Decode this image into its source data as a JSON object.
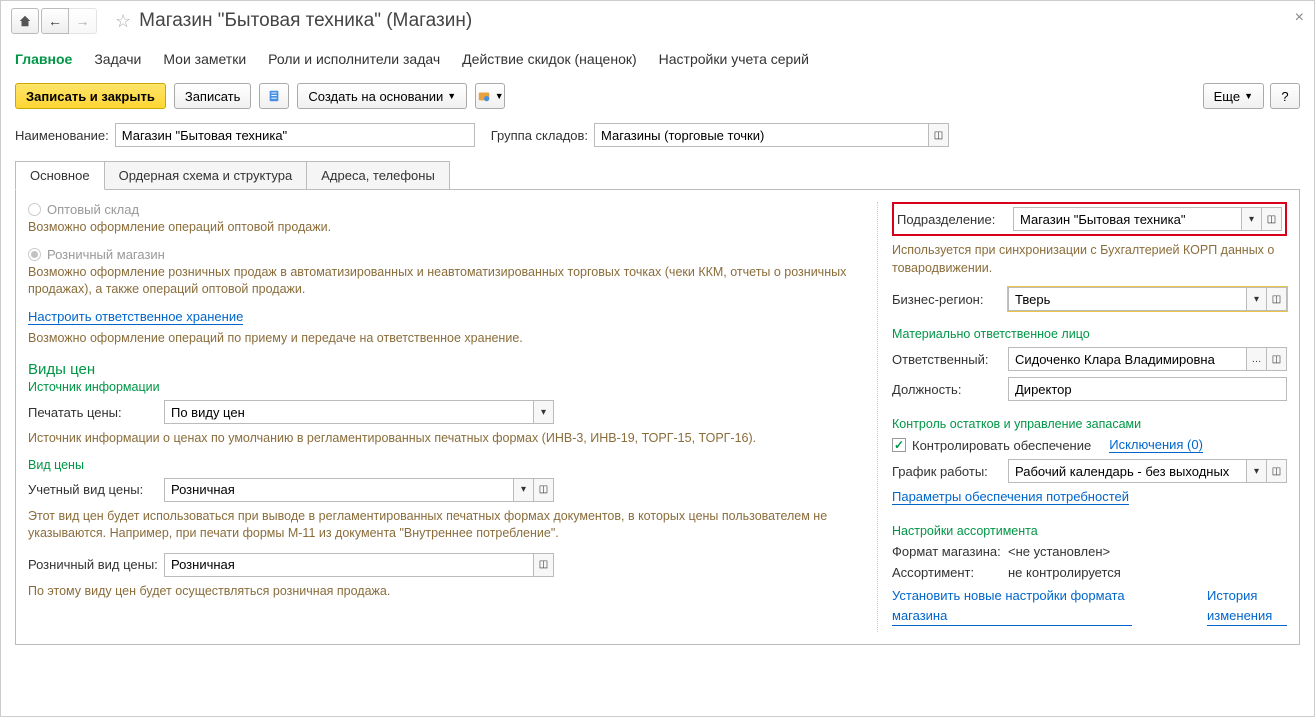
{
  "title": "Магазин \"Бытовая техника\"  (Магазин)",
  "nav": {
    "main": "Главное",
    "tasks": "Задачи",
    "notes": "Мои заметки",
    "roles": "Роли и исполнители задач",
    "discounts": "Действие скидок (наценок)",
    "series": "Настройки учета серий"
  },
  "toolbar": {
    "save_close": "Записать и закрыть",
    "save": "Записать",
    "create_based": "Создать на основании",
    "more": "Еще",
    "help": "?"
  },
  "header": {
    "name_label": "Наименование:",
    "name_value": "Магазин \"Бытовая техника\"",
    "group_label": "Группа складов:",
    "group_value": "Магазины (торговые точки)"
  },
  "subtabs": {
    "main": "Основное",
    "order": "Ордерная схема и структура",
    "address": "Адреса, телефоны"
  },
  "left": {
    "radio_wholesale": "Оптовый склад",
    "wholesale_desc": "Возможно оформление операций оптовой продажи.",
    "radio_retail": "Розничный магазин",
    "retail_desc": "Возможно оформление розничных продаж в автоматизированных и неавтоматизированных торговых точках (чеки ККМ, отчеты о розничных продажах), а также операций оптовой продажи.",
    "link_storage": "Настроить ответственное хранение",
    "storage_desc": "Возможно оформление операций по приему и передаче на ответственное хранение.",
    "prices_h": "Виды цен",
    "info_src": "Источник информации",
    "print_label": "Печатать цены:",
    "print_value": "По виду цен",
    "print_desc": "Источник информации о ценах по умолчанию в регламентированных печатных формах (ИНВ-3, ИНВ-19, ТОРГ-15, ТОРГ-16).",
    "price_type_h": "Вид цены",
    "acc_label": "Учетный вид цены:",
    "acc_value": "Розничная",
    "acc_desc": "Этот вид цен будет использоваться при выводе в регламентированных печатных формах документов, в которых цены пользователем не указываются. Например, при печати формы М-11 из документа \"Внутреннее потребление\".",
    "retail_price_label": "Розничный вид цены:",
    "retail_price_value": "Розничная",
    "retail_price_desc": "По этому виду цен будет осуществляться розничная продажа."
  },
  "right": {
    "dept_label": "Подразделение:",
    "dept_value": "Магазин \"Бытовая техника\"",
    "dept_desc": "Используется при синхронизации с Бухгалтерией КОРП данных о товародвижении.",
    "region_label": "Бизнес-регион:",
    "region_value": "Тверь",
    "resp_h": "Материально ответственное лицо",
    "resp_label": "Ответственный:",
    "resp_value": "Сидоченко Клара Владимировна",
    "pos_label": "Должность:",
    "pos_value": "Директор",
    "stock_h": "Контроль остатков и управление запасами",
    "control_label": "Контролировать обеспечение",
    "exceptions": "Исключения (0)",
    "sched_label": "График работы:",
    "sched_value": "Рабочий календарь - без выходных",
    "link_params": "Параметры обеспечения потребностей",
    "assort_h": "Настройки ассортимента",
    "format_label": "Формат магазина:",
    "format_value": "<не установлен>",
    "assort_label": "Ассортимент:",
    "assort_value": "не контролируется",
    "link_new_format": "Установить новые настройки формата магазина",
    "link_history": "История изменения"
  }
}
